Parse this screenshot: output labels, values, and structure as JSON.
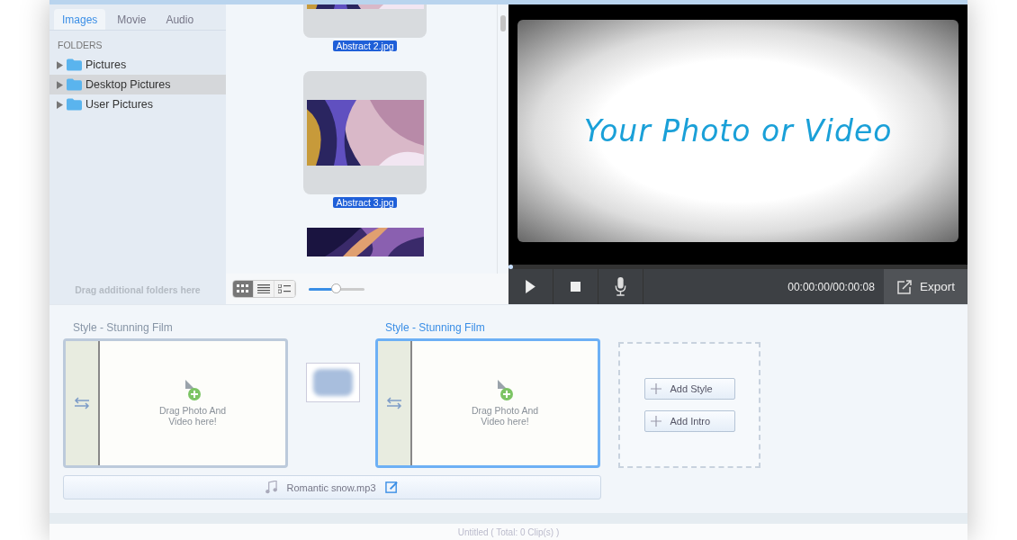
{
  "tabs": [
    {
      "label": "Images",
      "selected": true
    },
    {
      "label": "Movie",
      "selected": false
    },
    {
      "label": "Audio",
      "selected": false
    }
  ],
  "folders": {
    "header": "FOLDERS",
    "items": [
      {
        "label": "Pictures",
        "selected": false,
        "expanded": false
      },
      {
        "label": "Desktop Pictures",
        "selected": true,
        "expanded": false
      },
      {
        "label": "User Pictures",
        "selected": false,
        "expanded": false
      }
    ],
    "drop_hint": "Drag additional folders here"
  },
  "thumbnails": [
    {
      "kind": "labeled",
      "label": "Abstract 2.jpg",
      "selected": true
    },
    {
      "kind": "labeled",
      "label": "Abstract 3.jpg",
      "selected": true
    },
    {
      "kind": "partial"
    }
  ],
  "view_modes": [
    {
      "kind": "grid",
      "selected": true
    },
    {
      "kind": "list",
      "selected": false
    },
    {
      "kind": "detail",
      "selected": false
    }
  ],
  "zoom_slider": {
    "level": 0.5
  },
  "preview": {
    "placeholder": "Your Photo or Video",
    "time": "00:00:00/00:00:08",
    "export": "Export"
  },
  "timeline": {
    "clips": [
      {
        "style": "Style - Stunning Film",
        "hint": "Drag Photo And Video here!",
        "selected": false
      },
      {
        "style": "Style - Stunning Film",
        "hint": "Drag Photo And Video here!",
        "selected": true
      }
    ],
    "audio": "Romantic snow.mp3",
    "buttons": [
      "Add Style",
      "Add Intro"
    ]
  },
  "status": "Untitled ( Total: 0 Clip(s) )"
}
